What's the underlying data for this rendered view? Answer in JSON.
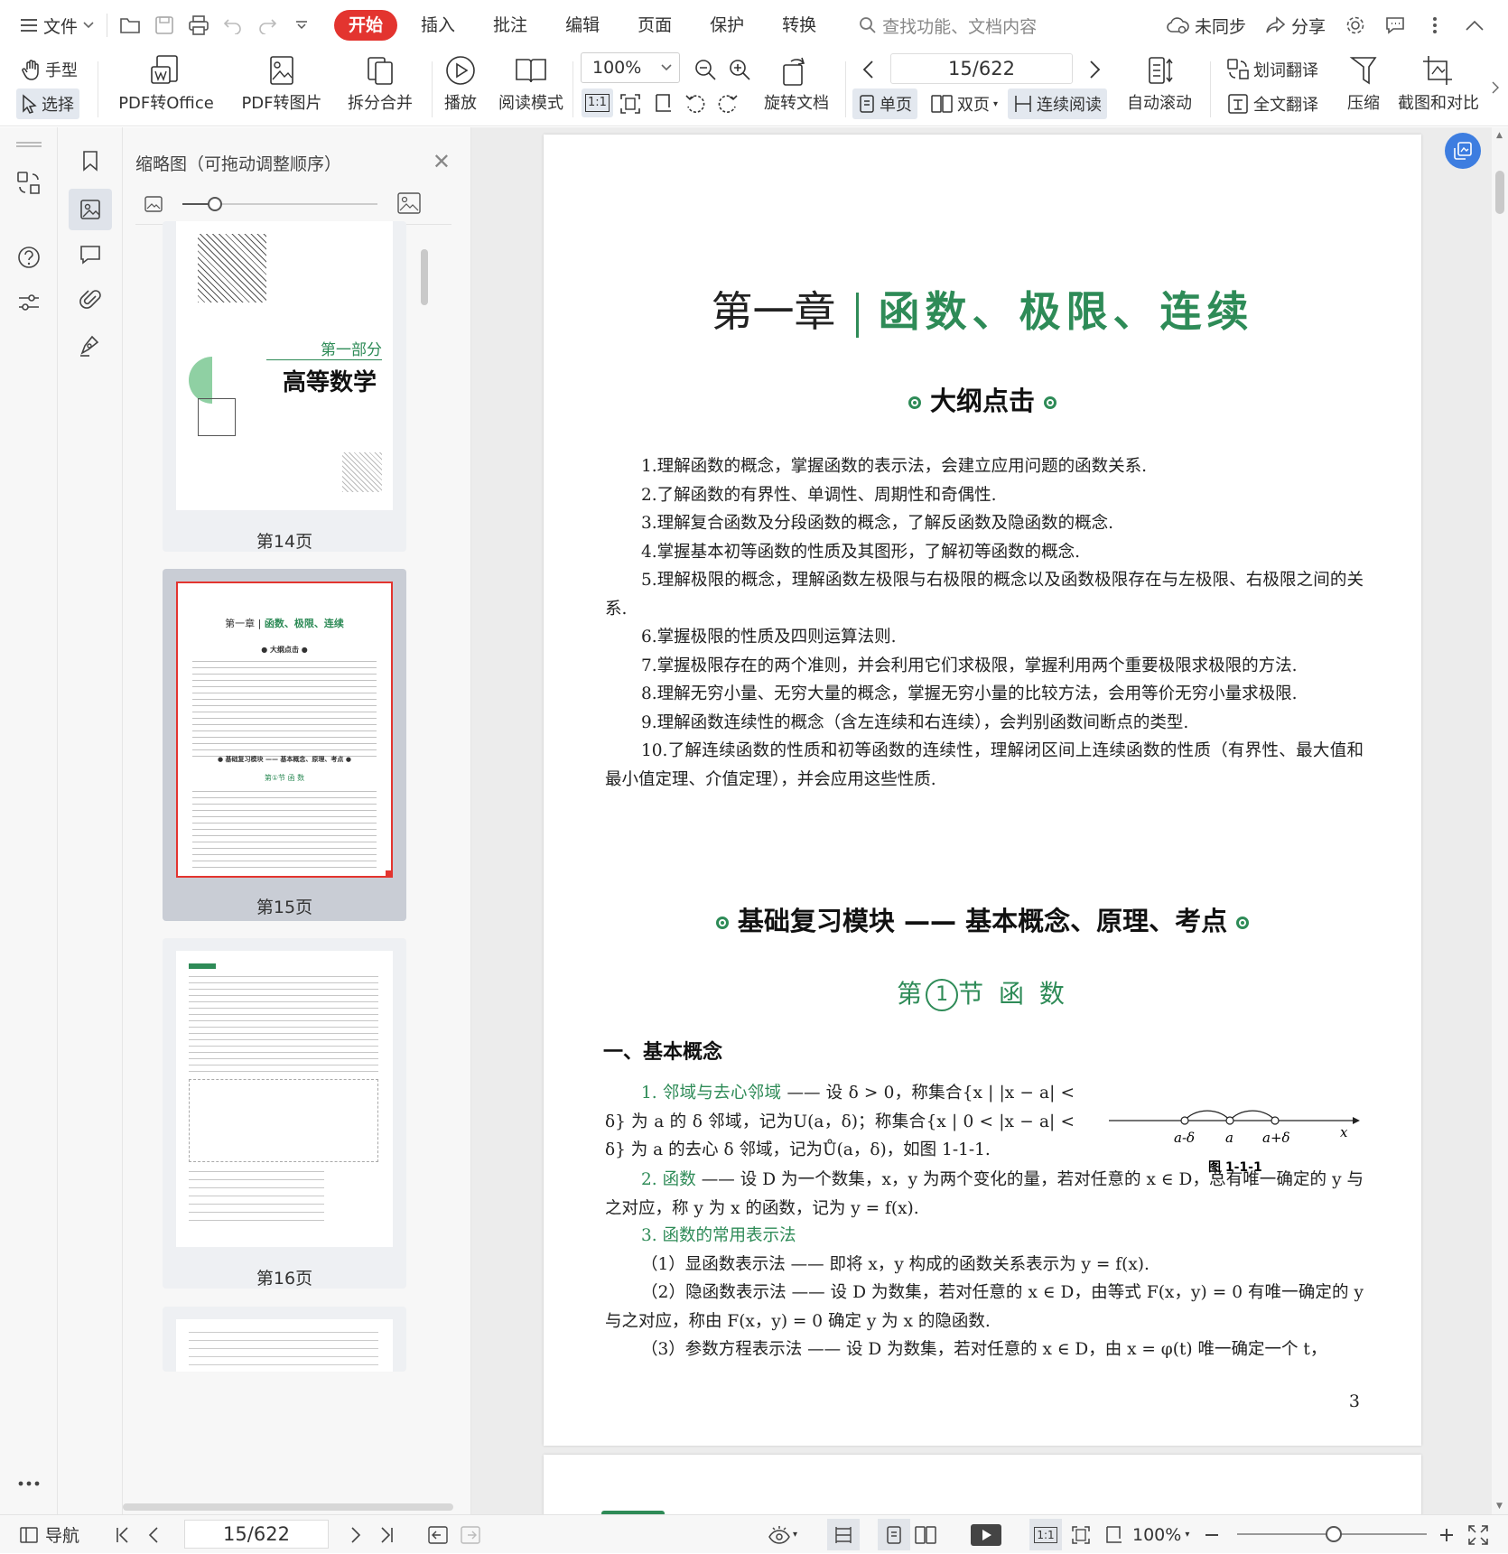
{
  "menubar": {
    "file_label": "文件",
    "tabs": [
      {
        "label": "开始",
        "active": true
      },
      {
        "label": "插入"
      },
      {
        "label": "批注"
      },
      {
        "label": "编辑"
      },
      {
        "label": "页面"
      },
      {
        "label": "保护"
      },
      {
        "label": "转换"
      }
    ],
    "search_placeholder": "查找功能、文档内容",
    "sync_label": "未同步",
    "share_label": "分享",
    "accent": "#e3342f"
  },
  "ribbon": {
    "hand_label": "手型",
    "select_label": "选择",
    "pdf_office": "PDF转Office",
    "pdf_image": "PDF转图片",
    "split_merge": "拆分合并",
    "play": "播放",
    "read_mode": "阅读模式",
    "zoom": "100%",
    "actual_size": "1:1",
    "rotate_doc": "旋转文档",
    "page_indicator": "15/622",
    "single_page": "单页",
    "double_page": "双页",
    "continuous": "连续阅读",
    "auto_scroll": "自动滚动",
    "word_translate": "划词翻译",
    "full_translate": "全文翻译",
    "compress": "压缩",
    "screenshot_compare": "截图和对比"
  },
  "thumbs": {
    "title": "缩略图（可拖动调整顺序）",
    "items": [
      {
        "caption": "第14页",
        "part": "第一部分",
        "subject": "高等数学"
      },
      {
        "caption": "第15页",
        "selected": true
      },
      {
        "caption": "第16页"
      }
    ]
  },
  "document": {
    "chapter_prefix": "第一章",
    "chapter_title": "函数、极限、连续",
    "outline_heading": "大纲点击",
    "outline_items": [
      "1.理解函数的概念，掌握函数的表示法，会建立应用问题的函数关系.",
      "2.了解函数的有界性、单调性、周期性和奇偶性.",
      "3.理解复合函数及分段函数的概念，了解反函数及隐函数的概念.",
      "4.掌握基本初等函数的性质及其图形，了解初等函数的概念.",
      "5.理解极限的概念，理解函数左极限与右极限的概念以及函数极限存在与左极限、右极限之间的关系.",
      "6.掌握极限的性质及四则运算法则.",
      "7.掌握极限存在的两个准则，并会利用它们求极限，掌握利用两个重要极限求极限的方法.",
      "8.理解无穷小量、无穷大量的概念，掌握无穷小量的比较方法，会用等价无穷小量求极限.",
      "9.理解函数连续性的概念（含左连续和右连续），会判别函数间断点的类型.",
      "10.了解连续函数的性质和初等函数的连续性，理解闭区间上连续函数的性质（有界性、最大值和最小值定理、介值定理），并会应用这些性质."
    ],
    "module_heading": "基础复习模块 —— 基本概念、原理、考点",
    "section_pre": "第",
    "section_num": "1",
    "section_post": "节  函 数",
    "sub_heading": "一、基本概念",
    "item1_label": "1. 邻域与去心邻域",
    "item1_text": " —— 设 δ > 0，称集合{x | |x − a| < δ} 为 a 的 δ 邻域，记为U(a，δ)；称集合{x | 0 < |x − a| < δ} 为 a 的去心 δ 邻域，记为Ů(a，δ)，如图 1-1-1.",
    "figure_caption": "图 1-1-1",
    "fig_labels": [
      "a-δ",
      "a",
      "a+δ",
      "x"
    ],
    "item2_label": "2. 函数",
    "item2_text": " —— 设 D 为一个数集，x，y 为两个变化的量，若对任意的 x ∈ D，总有唯一确定的 y 与之对应，称 y 为 x 的函数，记为 y = f(x).",
    "item3_label": "3. 函数的常用表示法",
    "rep1": "（1）显函数表示法 —— 即将 x，y 构成的函数关系表示为 y = f(x).",
    "rep2": "（2）隐函数表示法 —— 设 D 为数集，若对任意的 x ∈ D，由等式 F(x，y) = 0 有唯一确定的 y 与之对应，称由 F(x，y) = 0 确定 y 为 x 的隐函数.",
    "rep3": "（3）参数方程表示法 —— 设 D 为数集，若对任意的 x ∈ D，由 x = φ(t) 唯一确定一个 t，",
    "page_number": "3"
  },
  "statusbar": {
    "nav_label": "导航",
    "page_indicator": "15/622",
    "zoom": "100%"
  }
}
